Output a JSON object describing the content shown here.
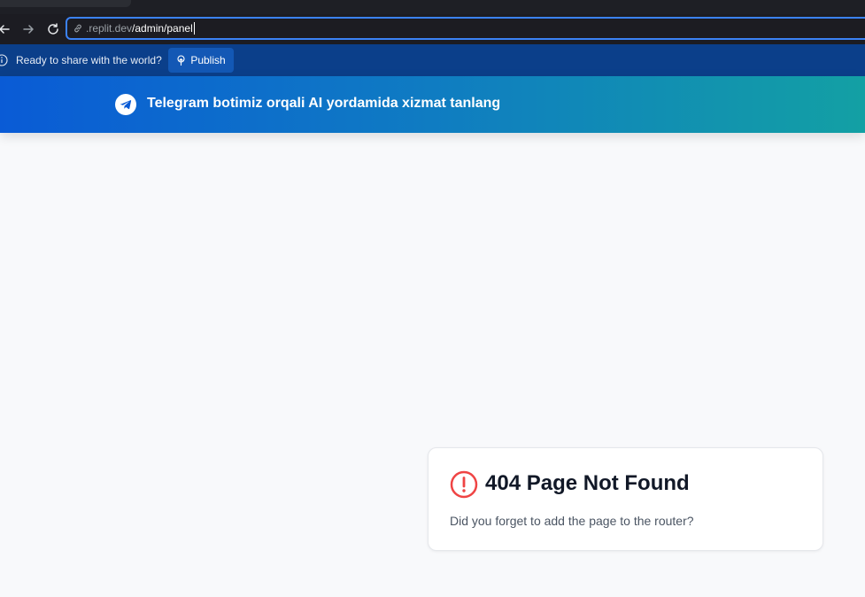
{
  "browser": {
    "url": {
      "host": ".replit.dev",
      "path": "/admin/panel"
    }
  },
  "infobar": {
    "message": "Ready to share with the world?",
    "publish_label": "Publish"
  },
  "banner": {
    "text": "Telegram botimiz orqali AI yordamida xizmat tanlang",
    "icon": "telegram-icon"
  },
  "not_found": {
    "title": "404 Page Not Found",
    "description": "Did you forget to add the page to the router?",
    "icon": "alert-circle-icon",
    "icon_color": "#ef4444"
  },
  "colors": {
    "banner_start": "#0a5bd6",
    "banner_end": "#13a0a4",
    "infobar_bg": "#0b3f8a",
    "page_bg": "#f8f9fb"
  }
}
